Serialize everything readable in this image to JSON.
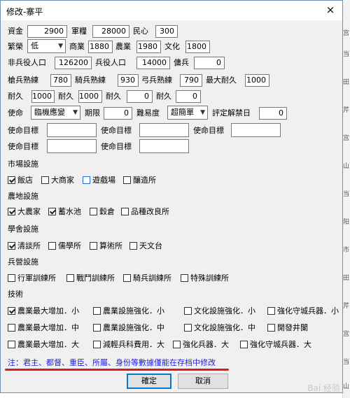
{
  "window": {
    "title": "修改-寨平",
    "close_icon": "×"
  },
  "rows": {
    "r1": {
      "funds_label": "資金",
      "funds": "2900",
      "food_label": "軍糧",
      "food": "28000",
      "morale_label": "民心",
      "morale": "300"
    },
    "r2": {
      "prosperity_label": "繁榮",
      "prosperity_value": "低",
      "commerce_label": "商業",
      "commerce": "1880",
      "agri_label": "農業",
      "agri": "1980",
      "culture_label": "文化",
      "culture": "1800"
    },
    "r3": {
      "nonmil_label": "非兵役人口",
      "nonmil": "126200",
      "mil_label": "兵役人口",
      "mil": "14000",
      "merc_label": "傭兵",
      "merc": "0"
    },
    "r4": {
      "spear_label": "槍兵熟練",
      "spear": "780",
      "cav_label": "騎兵熟練",
      "cav": "930",
      "bow_label": "弓兵熟練",
      "bow": "790",
      "maxdur_label": "最大耐久",
      "maxdur": "1000"
    },
    "r5": {
      "dur_label": "耐久",
      "dur1": "1000",
      "dur2": "1000",
      "dur3": "0",
      "dur4": "0"
    },
    "r6": {
      "mission_label": "使命",
      "mission_value": "臨機應變",
      "period_label": "期限",
      "period": "0",
      "difficulty_label": "難易度",
      "difficulty_value": "超簡單",
      "eval_label": "評定解禁日",
      "eval": "0"
    },
    "target_label": "使命目標"
  },
  "sections": {
    "market": {
      "title": "市場設施",
      "items": [
        {
          "label": "飯店",
          "checked": true
        },
        {
          "label": "大商家",
          "checked": false
        },
        {
          "label": "遊戲場",
          "checked": false
        },
        {
          "label": "釀造所",
          "checked": false
        }
      ]
    },
    "farm": {
      "title": "農地設施",
      "items": [
        {
          "label": "大農家",
          "checked": true
        },
        {
          "label": "蓄水池",
          "checked": true
        },
        {
          "label": "穀倉",
          "checked": false
        },
        {
          "label": "品種改良所",
          "checked": false
        }
      ]
    },
    "school": {
      "title": "學舍設施",
      "items": [
        {
          "label": "清談所",
          "checked": true
        },
        {
          "label": "儒學所",
          "checked": false
        },
        {
          "label": "算術所",
          "checked": false
        },
        {
          "label": "天文台",
          "checked": false
        }
      ]
    },
    "barracks": {
      "title": "兵營設施",
      "items": [
        {
          "label": "行軍訓練所",
          "checked": false
        },
        {
          "label": "戰鬥訓練所",
          "checked": false
        },
        {
          "label": "騎兵訓練所",
          "checked": false
        },
        {
          "label": "特殊訓練所",
          "checked": false
        }
      ]
    },
    "tech": {
      "title": "技術",
      "items": [
        {
          "label": "農業最大增加．小",
          "checked": true
        },
        {
          "label": "農業設施強化．小",
          "checked": false
        },
        {
          "label": "文化設施強化．小",
          "checked": false
        },
        {
          "label": "強化守城兵器．小",
          "checked": false
        },
        {
          "label": "農業最大增加．中",
          "checked": false
        },
        {
          "label": "農業設施強化．中",
          "checked": false
        },
        {
          "label": "文化設施強化．中",
          "checked": false
        },
        {
          "label": "開發井闌",
          "checked": false
        },
        {
          "label": "農業最大增加．大",
          "checked": false
        },
        {
          "label": "減輕兵科費用．大",
          "checked": false
        },
        {
          "label": "強化兵器．大",
          "checked": false
        },
        {
          "label": "強化守城兵器．大",
          "checked": false
        }
      ]
    }
  },
  "note": "注：君主、都督、重臣、所屬、身份等數據僅能在存档中修改",
  "buttons": {
    "ok": "確定",
    "cancel": "取消"
  },
  "watermark": "Bai 经验",
  "bg_chars": [
    "宫",
    "当",
    "田",
    "芹",
    "宫",
    "山",
    "当",
    "阳",
    "市",
    "田",
    "芹",
    "宫",
    "当",
    "山"
  ]
}
